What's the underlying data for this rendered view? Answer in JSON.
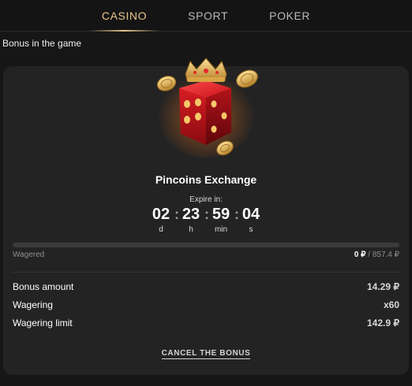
{
  "tabs": [
    {
      "label": "CASINO",
      "active": true
    },
    {
      "label": "SPORT",
      "active": false
    },
    {
      "label": "POKER",
      "active": false
    }
  ],
  "section_title": "Bonus in the game",
  "bonus": {
    "image_icon": "crowned-red-dice-with-coins",
    "name": "Pincoins Exchange",
    "expire_label": "Expire in:",
    "timer": [
      {
        "value": "02",
        "unit": "d"
      },
      {
        "value": "23",
        "unit": "h"
      },
      {
        "value": "59",
        "unit": "min"
      },
      {
        "value": "04",
        "unit": "s"
      }
    ],
    "timer_separator": ":",
    "wager_progress_percent": 0,
    "wagered_label": "Wagered",
    "wagered_current": "0 ₽",
    "wagered_total": "/ 857.4 ₽",
    "details": [
      {
        "label": "Bonus amount",
        "value": "14.29 ₽"
      },
      {
        "label": "Wagering",
        "value": "x60"
      },
      {
        "label": "Wagering limit",
        "value": "142.9 ₽"
      }
    ],
    "cancel_label": "CANCEL THE BONUS"
  },
  "colors": {
    "accent_gold": "#e7c58e",
    "background": "#161616",
    "card": "#232323",
    "dice_red": "#c8121a"
  }
}
